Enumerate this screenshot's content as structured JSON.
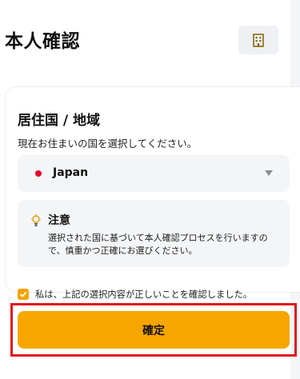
{
  "header": {
    "title": "本人確認",
    "icon": "building-icon"
  },
  "residence": {
    "title": "居住国 / 地域",
    "description": "現在お住まいの国を選択してください。",
    "selected_country": "Japan",
    "flag_color": "#e30b2f"
  },
  "notice": {
    "icon": "lightbulb-icon",
    "title": "注意",
    "body": "選択された国に基づいて本人確認プロセスを行いますので、慎重かつ正確にお選びください。"
  },
  "agreement": {
    "checked": true,
    "label": "私は、上記の選択内容が正しいことを確認しました。"
  },
  "actions": {
    "confirm_label": "確定"
  },
  "colors": {
    "accent": "#f7a600",
    "highlight": "#e3151e"
  }
}
